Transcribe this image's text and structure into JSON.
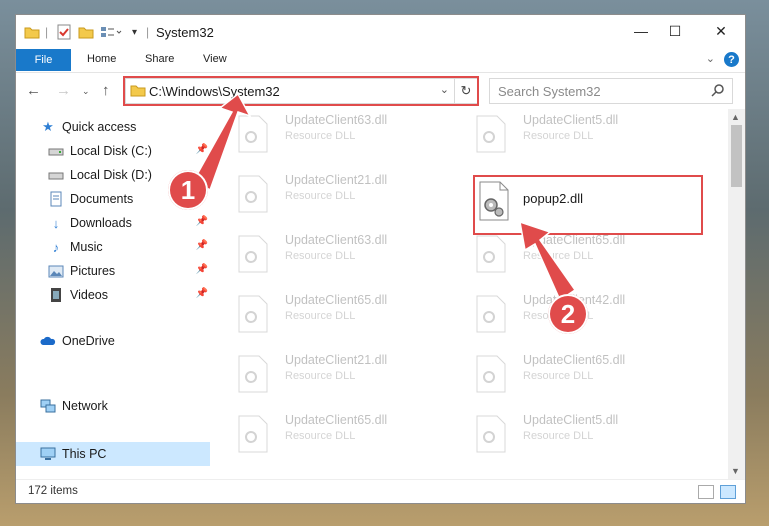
{
  "window": {
    "title": "System32",
    "controls": {
      "minimize": "—",
      "maximize": "☐",
      "close": "✕"
    }
  },
  "ribbon": {
    "file_tab": "File",
    "tabs": [
      "Home",
      "Share",
      "View"
    ],
    "help": "?"
  },
  "address": {
    "path": "C:\\Windows\\System32",
    "search_placeholder": "Search System32"
  },
  "nav": {
    "quick_access": "Quick access",
    "items": [
      {
        "label": "Local Disk (C:)",
        "icon": "drive-icon",
        "pinned": true
      },
      {
        "label": "Local Disk (D:)",
        "icon": "drive-icon",
        "pinned": false
      },
      {
        "label": "Documents",
        "icon": "documents-icon",
        "pinned": true
      },
      {
        "label": "Downloads",
        "icon": "downloads-icon",
        "pinned": true
      },
      {
        "label": "Music",
        "icon": "music-icon",
        "pinned": true
      },
      {
        "label": "Pictures",
        "icon": "pictures-icon",
        "pinned": true
      },
      {
        "label": "Videos",
        "icon": "videos-icon",
        "pinned": true
      }
    ],
    "onedrive": "OneDrive",
    "this_pc": "This PC",
    "network": "Network"
  },
  "files": {
    "description": "Resource DLL",
    "left_column": [
      "UpdateClient63.dll",
      "UpdateClient21.dll",
      "UpdateClient63.dll",
      "UpdateClient65.dll",
      "UpdateClient21.dll",
      "UpdateClient65.dll"
    ],
    "right_column": [
      "UpdateClient5.dll",
      "UpdateClient65.dll",
      "UpdateClient42.dll",
      "UpdateClient65.dll",
      "UpdateClient5.dll"
    ],
    "highlighted": "popup2.dll"
  },
  "status": {
    "item_count": "172 items"
  },
  "annotations": {
    "step1": "1",
    "step2": "2",
    "color": "#e04b4b"
  }
}
